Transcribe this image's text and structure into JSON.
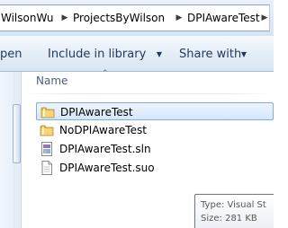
{
  "address_bar": {
    "breadcrumbs": [
      "WilsonWu",
      "ProjectsByWilson",
      "DPIAwareTest"
    ],
    "separator_icon": "chevron-right-icon"
  },
  "toolbar": {
    "open_label": "pen",
    "include_label": "Include in library",
    "share_label": "Share with",
    "dropdown_icon": "triangle-down-icon"
  },
  "file_list": {
    "column_header": "Name",
    "sort_icon": "chevron-up-icon",
    "items": [
      {
        "name": "DPIAwareTest",
        "icon": "folder-icon",
        "selected": true
      },
      {
        "name": "NoDPIAwareTest",
        "icon": "folder-icon",
        "selected": false
      },
      {
        "name": "DPIAwareTest.sln",
        "icon": "solution-file-icon",
        "selected": false
      },
      {
        "name": "DPIAwareTest.suo",
        "icon": "generic-file-icon",
        "selected": false
      }
    ]
  },
  "tooltip": {
    "type_line": "Type: Visual St",
    "size_line": "Size: 281 KB"
  },
  "colors": {
    "toolbar_text": "#1e395b",
    "selection_border": "#84acdd",
    "selection_fill": "#d6e7fb",
    "folder_yellow": "#f2c24b"
  }
}
